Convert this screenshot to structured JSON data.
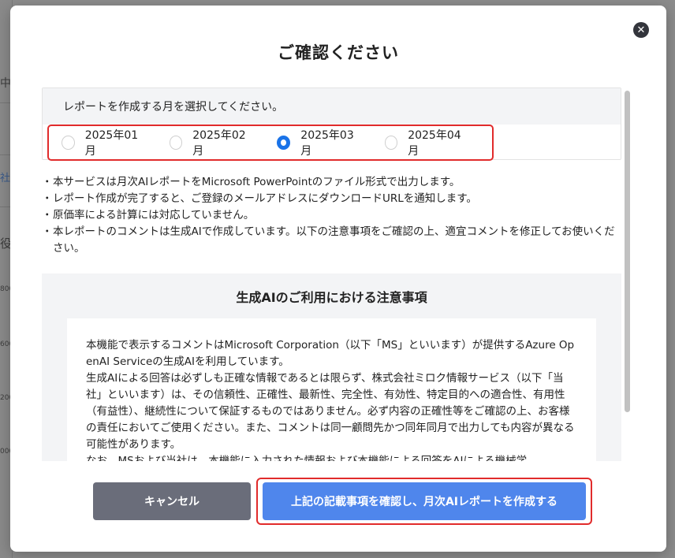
{
  "background": {
    "fragments": [
      "中",
      "正",
      "社",
      "役",
      "000",
      "800",
      "600",
      "400",
      "200"
    ]
  },
  "modal": {
    "title": "ご確認ください",
    "close_label": "✕",
    "month_select": {
      "heading": "レポートを作成する月を選択してください。",
      "options": [
        {
          "label": "2025年01月",
          "checked": false
        },
        {
          "label": "2025年02月",
          "checked": false
        },
        {
          "label": "2025年03月",
          "checked": true
        },
        {
          "label": "2025年04月",
          "checked": false
        }
      ]
    },
    "notes": [
      "本サービスは月次AIレポートをMicrosoft PowerPointのファイル形式で出力します。",
      "レポート作成が完了すると、ご登録のメールアドレスにダウンロードURLを通知します。",
      "原価率による計算には対応していません。",
      "本レポートのコメントは生成AIで作成しています。以下の注意事項をご確認の上、適宜コメントを修正してお使いください。"
    ],
    "note_bullet": "・",
    "caution": {
      "title": "生成AIのご利用における注意事項",
      "paragraphs": [
        "本機能で表示するコメントはMicrosoft Corporation（以下「MS」といいます）が提供するAzure OpenAI Serviceの生成AIを利用しています。",
        "生成AIによる回答は必ずしも正確な情報であるとは限らず、株式会社ミロク情報サービス（以下「当社」といいます）は、その信頼性、正確性、最新性、完全性、有効性、特定目的への適合性、有用性（有益性）、継続性について保証するものではありません。必ず内容の正確性等をご確認の上、お客様の責任においてご使用ください。また、コメントは同一顧問先かつ同年同月で出力しても内容が異なる可能性があります。",
        "なお、MSおよび当社は、本機能に入力された情報および本機能による回答をAIによる機械学"
      ]
    },
    "buttons": {
      "cancel": "キャンセル",
      "create": "上記の記載事項を確認し、月次AIレポートを作成する"
    }
  },
  "colors": {
    "accent": "#1a73e8",
    "primary_button": "#4f86ec",
    "cancel_button": "#6a6d7a",
    "highlight": "#e12b2b"
  }
}
